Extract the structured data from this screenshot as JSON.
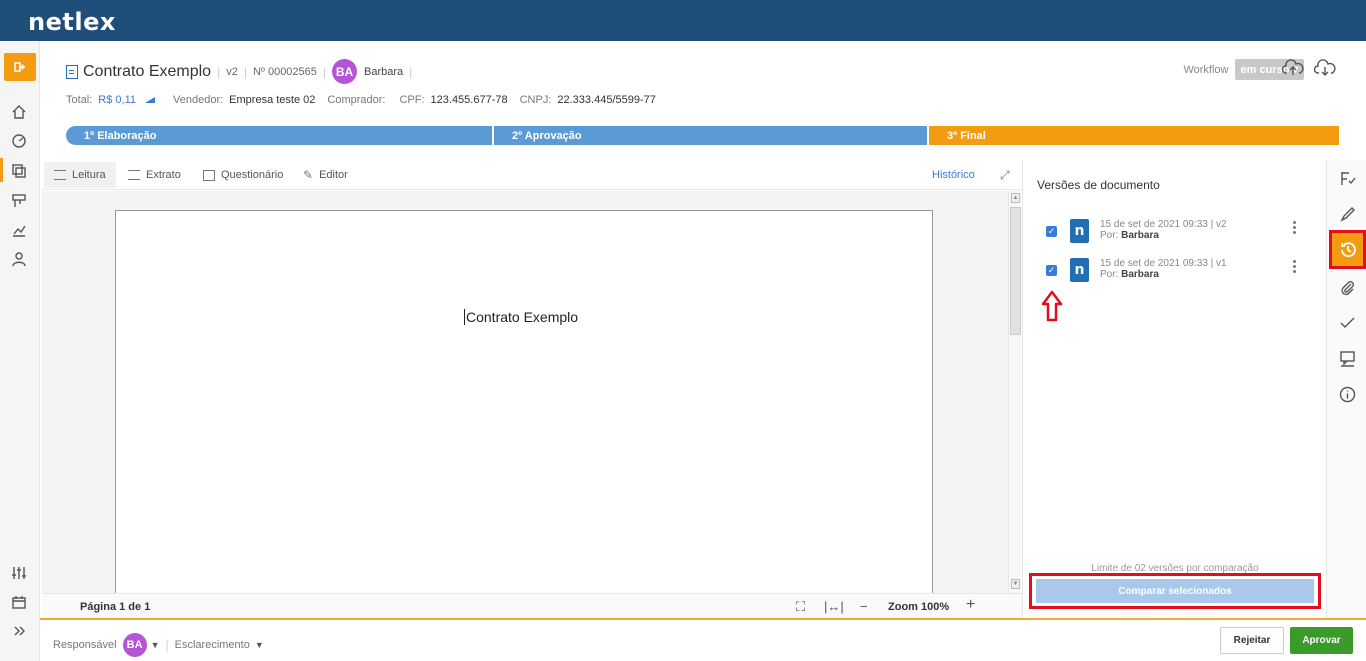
{
  "app": {
    "logo": "netlex"
  },
  "document": {
    "title": "Contrato Exemplo",
    "version": "v2",
    "number": "Nº 00002565",
    "owner_initials": "BA",
    "owner_name": "Barbara",
    "total_label": "Total:",
    "total_value": "R$ 0,11",
    "seller_label": "Vendedor:",
    "seller_value": "Empresa teste 02",
    "buyer_label": "Comprador:",
    "cpf_label": "CPF:",
    "cpf_value": "123.455.677-78",
    "cnpj_label": "CNPJ:",
    "cnpj_value": "22.333.445/5599-77"
  },
  "workflow": {
    "label": "Workflow",
    "status": "em curso"
  },
  "stages": [
    "1º Elaboração",
    "2º Aprovação",
    "3º Final"
  ],
  "tabs": [
    "Leitura",
    "Extrato",
    "Questionário",
    "Editor"
  ],
  "history_link": "Histórico",
  "paper": {
    "content": "Contrato Exemplo"
  },
  "pagebar": {
    "page": "Página 1 de 1",
    "zoom": "Zoom 100%"
  },
  "versions_panel": {
    "title": "Versões de documento",
    "items": [
      {
        "date": "15 de set de 2021 09:33 | v2",
        "by_label": "Por:",
        "by_name": "Barbara"
      },
      {
        "date": "15 de set de 2021 09:33 | v1",
        "by_label": "Por:",
        "by_name": "Barbara"
      }
    ],
    "limit_text": "Limite de 02 versões por comparação",
    "compare_button": "Comparar selecionados"
  },
  "footer": {
    "responsible_label": "Responsável",
    "responsible_initials": "BA",
    "clarification": "Esclarecimento",
    "reject": "Rejeitar",
    "approve": "Aprovar"
  },
  "colors": {
    "brand": "#1f4e79",
    "accent": "#f39c12",
    "stage_blue": "#5b9bd5",
    "approve": "#3a9b2a",
    "highlight": "#e20d1d"
  }
}
